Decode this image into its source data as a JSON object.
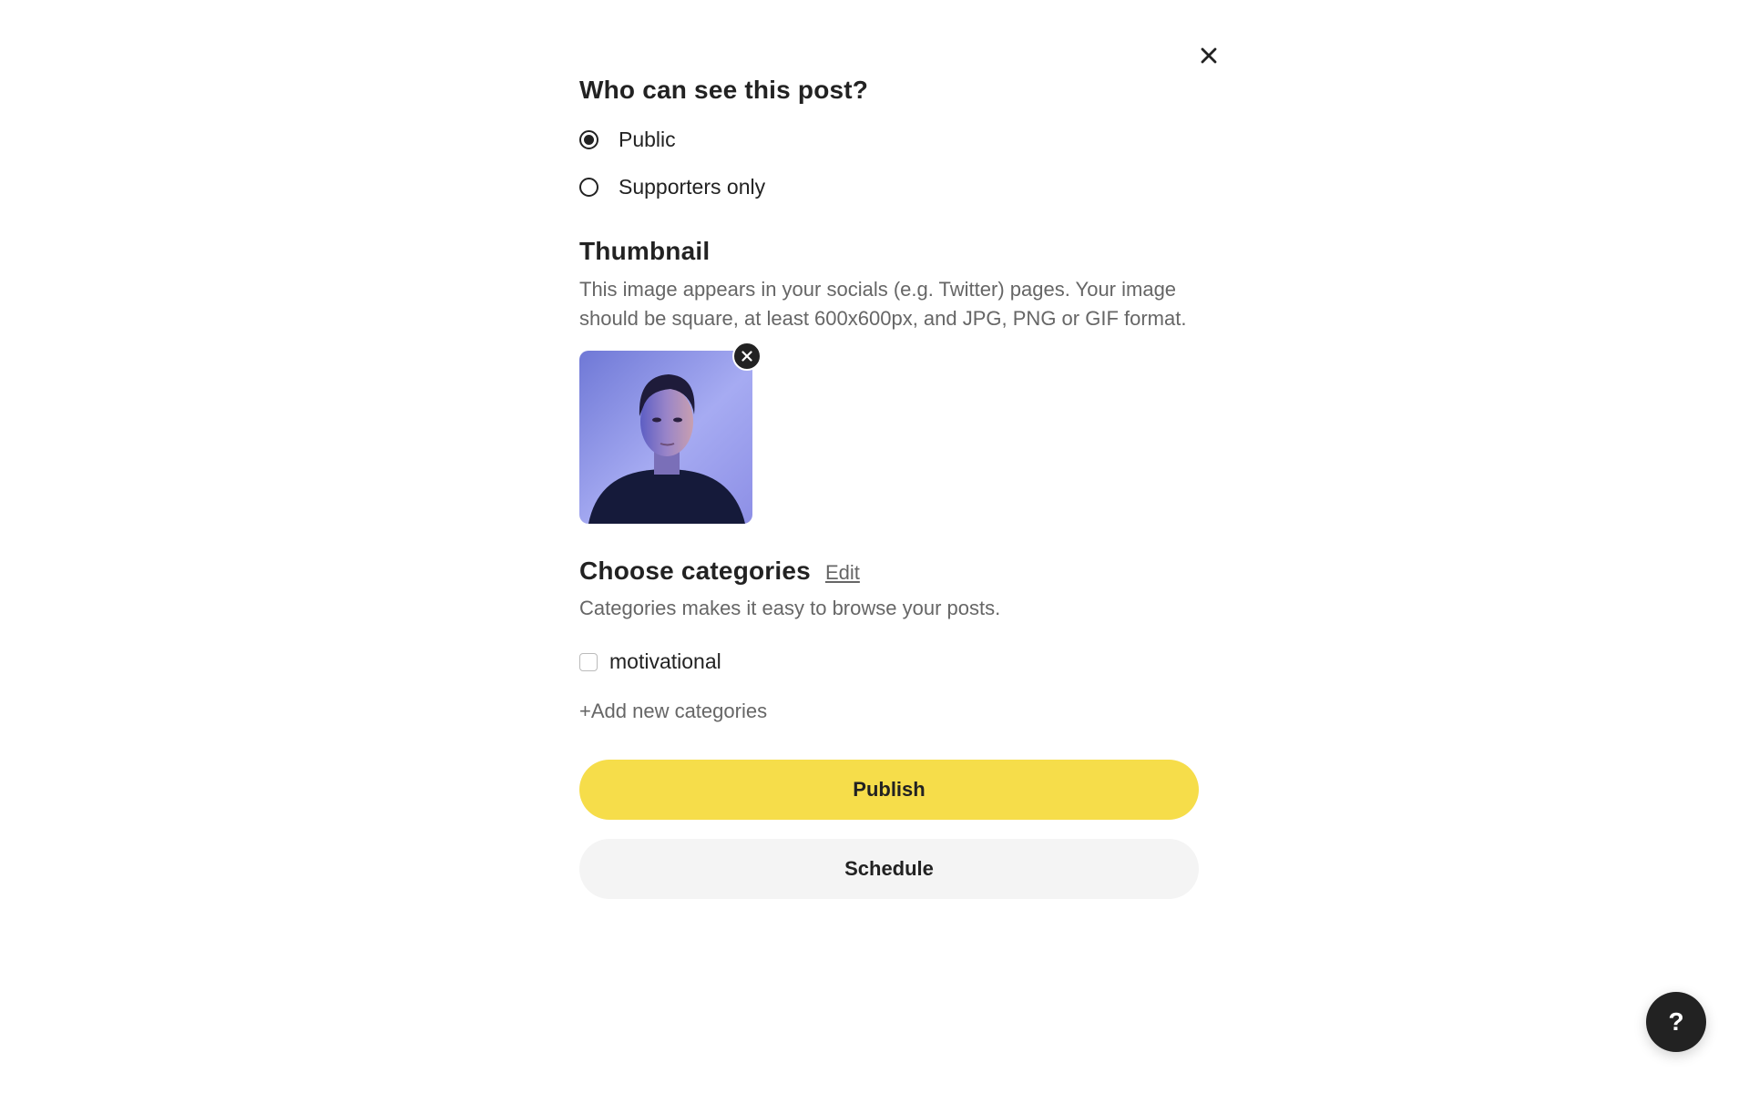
{
  "colors": {
    "text": "#222222",
    "muted": "#666666",
    "publish_bg": "#f6dd4a",
    "schedule_bg": "#f4f4f4",
    "help_bg": "#222222"
  },
  "icons": {
    "close": "close-icon",
    "thumb_remove": "remove-circle-icon",
    "help": "question-mark-icon"
  },
  "visibility": {
    "title": "Who can see this post?",
    "options": [
      {
        "label": "Public",
        "selected": true
      },
      {
        "label": "Supporters only",
        "selected": false
      }
    ]
  },
  "thumbnail": {
    "title": "Thumbnail",
    "description_line1": "This image appears in your socials (e.g. Twitter) pages. Your image",
    "description_line2": "should be square, at least 600x600px, and JPG, PNG or GIF format."
  },
  "categories": {
    "title": "Choose categories",
    "edit_label": "Edit",
    "description": "Categories makes it easy to browse your posts.",
    "items": [
      {
        "label": "motivational",
        "checked": false
      }
    ],
    "add_label": "+Add new categories"
  },
  "actions": {
    "publish_label": "Publish",
    "schedule_label": "Schedule"
  },
  "help": {
    "label": "?"
  }
}
